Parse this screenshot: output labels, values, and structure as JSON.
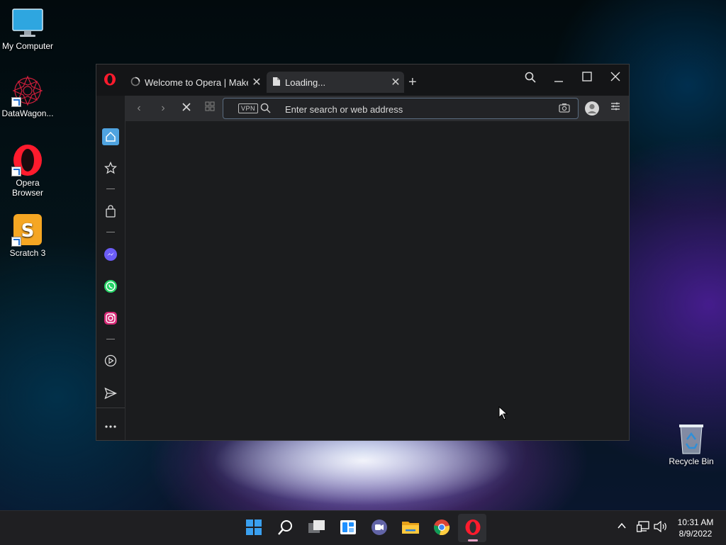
{
  "desktop": {
    "icons": [
      {
        "label": "My Computer",
        "icon": "monitor-icon"
      },
      {
        "label": "DataWagon...",
        "icon": "datawagon-icon"
      },
      {
        "label": "Opera Browser",
        "icon": "opera-icon"
      },
      {
        "label": "Scratch 3",
        "icon": "scratch-icon"
      },
      {
        "label": "Recycle Bin",
        "icon": "recycle-bin-icon"
      }
    ]
  },
  "browser": {
    "tabs": [
      {
        "title": "Welcome to Opera | Make",
        "state": "loading-spinner"
      },
      {
        "title": "Loading...",
        "state": "active"
      }
    ],
    "address": {
      "placeholder": "Enter search or web address",
      "vpn_label": "VPN"
    },
    "colors": {
      "sidebar_home_active": "#4fa3e0",
      "opera_red": "#ff1b2d"
    }
  },
  "taskbar": {
    "apps": [
      "start-icon",
      "search-icon",
      "task-view-icon",
      "widgets-icon",
      "teams-chat-icon",
      "file-explorer-icon",
      "chrome-icon",
      "opera-icon"
    ],
    "clock": {
      "time": "10:31 AM",
      "date": "8/9/2022"
    }
  }
}
